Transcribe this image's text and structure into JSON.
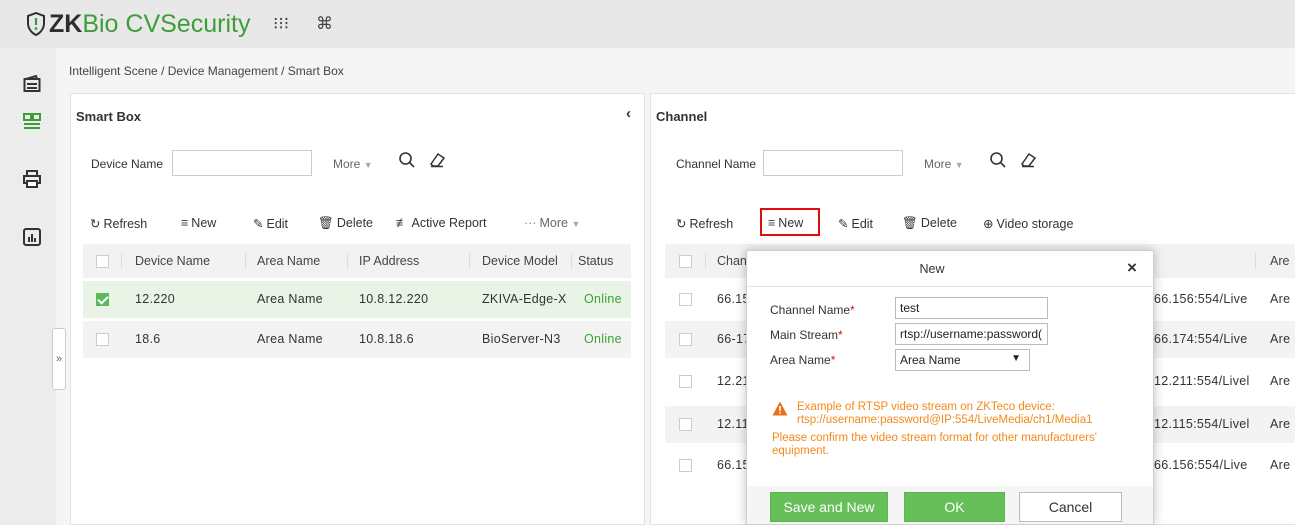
{
  "app": {
    "brand_zk": "ZK",
    "brand_rest": "Bio CVSecurity",
    "grid_icon_glyph": "⁝⁝⁝",
    "cmd_icon_glyph": "⌘",
    "colors": {
      "brand_green": "#3d9e38",
      "button_green": "#66bf58",
      "highlight_red": "#e00b0b",
      "warning_orange": "#f28a1a"
    }
  },
  "sidebar": {
    "icons": [
      "access-card-icon",
      "grid-devices-icon",
      "printer-icon",
      "report-chart-icon"
    ],
    "collapse_glyph": "»"
  },
  "breadcrumb": "Intelligent Scene / Device Management / Smart Box",
  "smart_box": {
    "title": "Smart Box",
    "collapse_glyph": "‹",
    "filter_label": "Device Name",
    "more_label": "More",
    "toolbar": {
      "refresh": "Refresh",
      "new": "New",
      "edit": "Edit",
      "delete": "Delete",
      "active_report": "Active Report",
      "more": "More"
    },
    "columns": [
      "Device Name",
      "Area Name",
      "IP Address",
      "Device Model",
      "Status"
    ],
    "rows": [
      {
        "checked": true,
        "device_name": "12.220",
        "area_name": "Area Name",
        "ip": "10.8.12.220",
        "model": "ZKIVA-Edge-X",
        "status": "Online"
      },
      {
        "checked": false,
        "device_name": "18.6",
        "area_name": "Area Name",
        "ip": "10.8.18.6",
        "model": "BioServer-N3",
        "status": "Online"
      }
    ]
  },
  "channel": {
    "title": "Channel",
    "filter_label": "Channel Name",
    "more_label": "More",
    "toolbar": {
      "refresh": "Refresh",
      "new": "New",
      "edit": "Edit",
      "delete": "Delete",
      "video_storage": "Video storage"
    },
    "columns": {
      "first": "Chan",
      "last": "Are"
    },
    "rows": [
      {
        "name": "66.15",
        "stream_tail": "66.156:554/Live",
        "area": "Are"
      },
      {
        "name": "66-17",
        "stream_tail": "66.174:554/Live",
        "area": "Are"
      },
      {
        "name": "12.21",
        "stream_tail": "12.211:554/Livel",
        "area": "Are"
      },
      {
        "name": "12.11",
        "stream_tail": "12.115:554/Livel",
        "area": "Are"
      },
      {
        "name": "66.15",
        "stream_tail": "66.156:554/Live",
        "area": "Are"
      }
    ]
  },
  "dialog": {
    "title": "New",
    "close_glyph": "×",
    "channel_name_label": "Channel Name",
    "channel_name_value": "test",
    "main_stream_label": "Main Stream",
    "main_stream_value": "rtsp://username:password(",
    "area_name_label": "Area Name",
    "area_name_value": "Area Name",
    "required_mark": "*",
    "warning_line1": "Example of RTSP video stream on ZKTeco device:",
    "warning_line2": "rtsp://username:password@IP:554/LiveMedia/ch1/Media1",
    "note_line1": "Please confirm the video stream format for other manufacturers'",
    "note_line2": "equipment.",
    "save_and_new": "Save and New",
    "ok": "OK",
    "cancel": "Cancel"
  }
}
